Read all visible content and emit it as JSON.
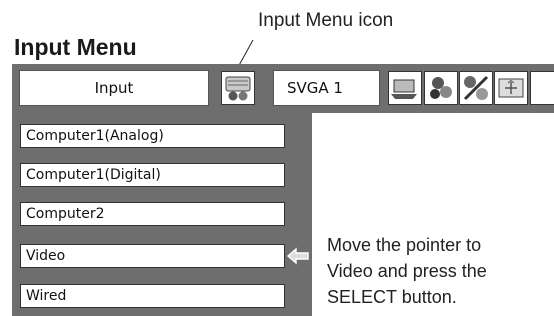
{
  "callout_label": "Input Menu icon",
  "heading": "Input Menu",
  "menubar": {
    "input_label": "Input",
    "signal_label": "SVGA 1",
    "icons": [
      "input-menu-icon",
      "computer-icon",
      "image-adjust-icon",
      "color-adjust-icon",
      "screen-icon"
    ]
  },
  "sidebar": {
    "items": [
      {
        "label": "Computer1(Analog)"
      },
      {
        "label": "Computer1(Digital)"
      },
      {
        "label": "Computer2"
      },
      {
        "label": "Video"
      },
      {
        "label": "Wired"
      }
    ],
    "pointer_icon": "left-arrow-pointer-icon"
  },
  "instruction": {
    "line1": "Move the pointer to",
    "line2": "Video and press the",
    "line3": "SELECT button."
  }
}
